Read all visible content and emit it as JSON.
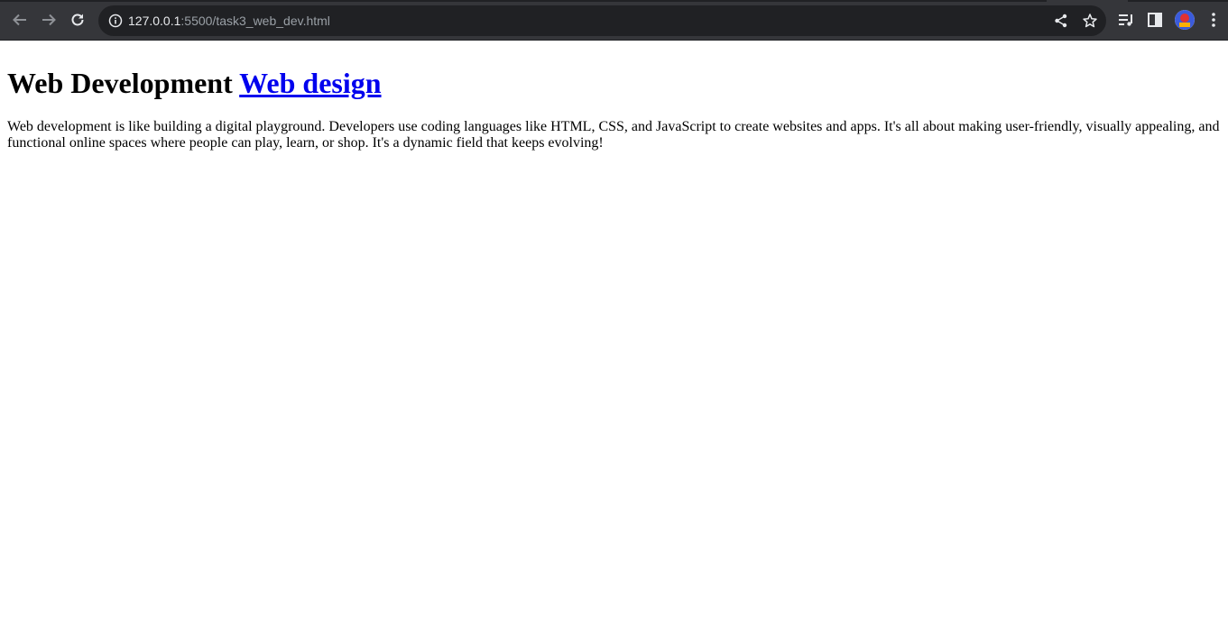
{
  "browser": {
    "url_host": "127.0.0.1",
    "url_rest": ":5500/task3_web_dev.html",
    "icons": [
      "back-icon",
      "forward-icon",
      "reload-icon",
      "site-info-icon",
      "share-icon",
      "bookmark-star-icon",
      "media-control-icon",
      "side-panel-icon",
      "profile-avatar",
      "more-menu-icon"
    ]
  },
  "page": {
    "heading_text": "Web Development",
    "heading_link": "Web design",
    "paragraph": "Web development is like building a digital playground. Developers use coding languages like HTML, CSS, and JavaScript to create websites and apps. It's all about making user-friendly, visually appealing, and functional online spaces where people can play, learn, or shop. It's a dynamic field that keeps evolving!"
  },
  "colors": {
    "toolbar_bg": "#35363a",
    "omnibox_bg": "#202124",
    "link": "#0000ee"
  }
}
